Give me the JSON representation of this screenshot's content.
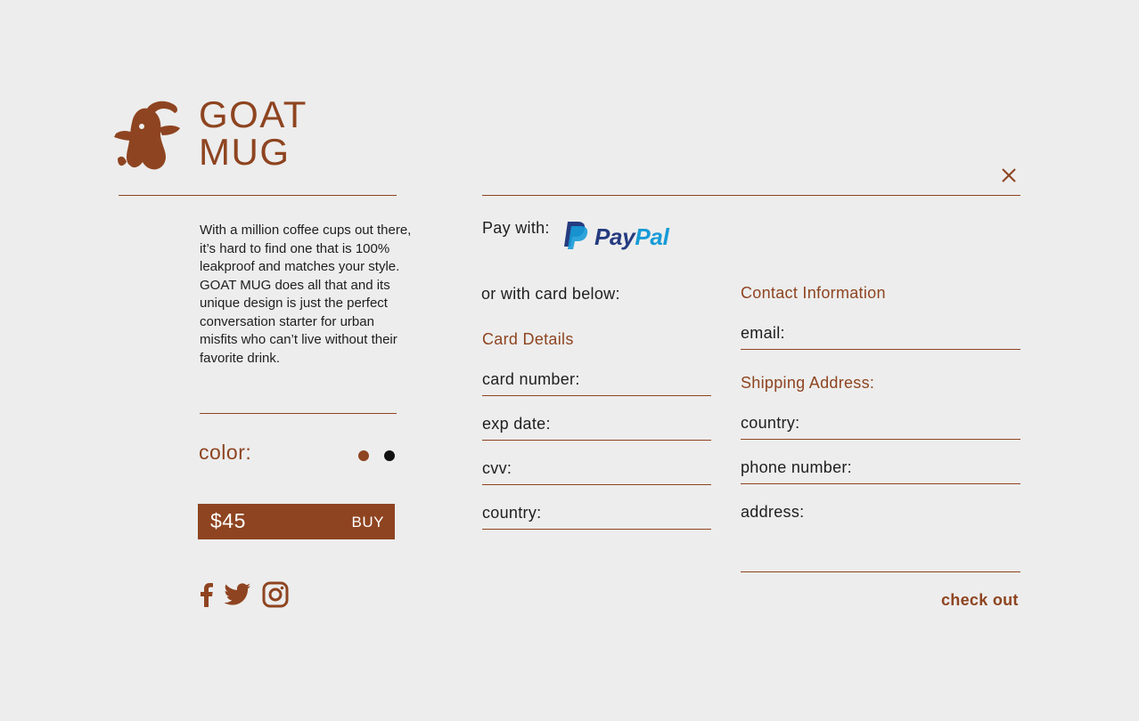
{
  "brand": {
    "line1": "GOAT",
    "line2": "MUG",
    "logo_icon": "goat-head-icon"
  },
  "product": {
    "description": "With a million coffee cups out there, it’s hard to find one that is 100% leakproof and matches your style. GOAT MUG does all that and its unique design is just the perfect conversation starter for urban misfits who can’t live without their favorite drink.",
    "color_label": "color:",
    "color_options": [
      "#8e4420",
      "#111111"
    ],
    "price": "$45",
    "buy_label": "BUY"
  },
  "social": [
    "facebook-icon",
    "twitter-icon",
    "instagram-icon"
  ],
  "checkout_panel": {
    "close_icon": "close-icon",
    "pay_with_label": "Pay with:",
    "paypal": {
      "pay": "Pay",
      "pal": "Pal"
    },
    "or_card_label": "or with card below:",
    "card_section": {
      "title": "Card Details",
      "fields": {
        "card_number": "card number:",
        "exp_date": "exp date:",
        "cvv": "cvv:",
        "country": "country:"
      }
    },
    "contact_section": {
      "title": "Contact Information",
      "email": "email:"
    },
    "shipping_section": {
      "title": "Shipping Address:",
      "fields": {
        "country": "country:",
        "phone": "phone number:",
        "address": "address:"
      }
    },
    "checkout_label": "check out"
  },
  "colors": {
    "accent": "#8e4420",
    "background": "#ededed",
    "text": "#1e1e1e",
    "paypal_dark": "#253b80",
    "paypal_light": "#179bd7"
  }
}
